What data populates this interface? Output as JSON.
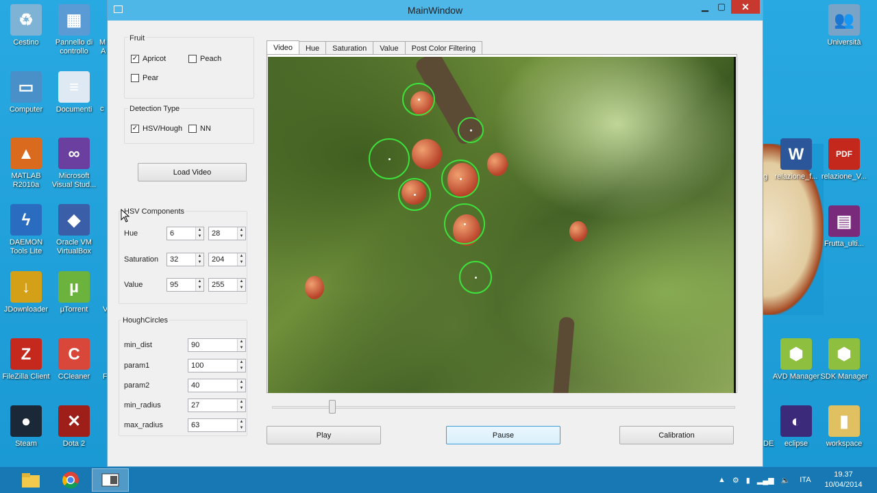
{
  "window": {
    "title": "MainWindow"
  },
  "fruit": {
    "title": "Fruit",
    "options": [
      {
        "label": "Apricot",
        "checked": true
      },
      {
        "label": "Peach",
        "checked": false
      },
      {
        "label": "Pear",
        "checked": false
      }
    ]
  },
  "detection": {
    "title": "Detection Type",
    "options": [
      {
        "label": "HSV/Hough",
        "checked": true
      },
      {
        "label": "NN",
        "checked": false
      }
    ]
  },
  "load_video_label": "Load Video",
  "hsv": {
    "title": "HSV Components",
    "rows": [
      {
        "label": "Hue",
        "min": "6",
        "max": "28"
      },
      {
        "label": "Saturation",
        "min": "32",
        "max": "204"
      },
      {
        "label": "Value",
        "min": "95",
        "max": "255"
      }
    ]
  },
  "hough": {
    "title": "HoughCircles",
    "rows": [
      {
        "label": "min_dist",
        "value": "90"
      },
      {
        "label": "param1",
        "value": "100"
      },
      {
        "label": "param2",
        "value": "40"
      },
      {
        "label": "min_radius",
        "value": "27"
      },
      {
        "label": "max_radius",
        "value": "63"
      }
    ]
  },
  "tabs": [
    "Video",
    "Hue",
    "Saturation",
    "Value",
    "Post Color Filtering"
  ],
  "active_tab": "Video",
  "playback": {
    "slider_position_fraction": 0.13
  },
  "controls": {
    "play": "Play",
    "pause": "Pause",
    "calibration": "Calibration"
  },
  "desktop_left": [
    {
      "label": "Cestino",
      "icon": "recycle-bin-icon",
      "color": "#7fb3d6",
      "glyph": "♻"
    },
    {
      "label": "Pannello di controllo",
      "icon": "control-panel-icon",
      "color": "#5b9bd5",
      "glyph": "▦"
    },
    {
      "label": "Computer",
      "icon": "computer-icon",
      "color": "#4a90c8",
      "glyph": "▭"
    },
    {
      "label": "Documenti",
      "icon": "documents-icon",
      "color": "#dfe9f3",
      "glyph": "≡"
    },
    {
      "label": "MATLAB R2010a",
      "icon": "matlab-icon",
      "color": "#d96a1e",
      "glyph": "▲"
    },
    {
      "label": "Microsoft Visual Stud...",
      "icon": "visual-studio-icon",
      "color": "#6a3fa0",
      "glyph": "∞"
    },
    {
      "label": "DAEMON Tools Lite",
      "icon": "daemon-tools-icon",
      "color": "#2a6cc0",
      "glyph": "ϟ"
    },
    {
      "label": "Oracle VM VirtualBox",
      "icon": "virtualbox-icon",
      "color": "#3a5ea8",
      "glyph": "◆"
    },
    {
      "label": "JDownloader",
      "icon": "jdownloader-icon",
      "color": "#d4a017",
      "glyph": "↓"
    },
    {
      "label": "µTorrent",
      "icon": "utorrent-icon",
      "color": "#6cb33e",
      "glyph": "µ"
    },
    {
      "label": "FileZilla Client",
      "icon": "filezilla-icon",
      "color": "#c5281c",
      "glyph": "Z"
    },
    {
      "label": "CCleaner",
      "icon": "ccleaner-icon",
      "color": "#d8473a",
      "glyph": "C"
    },
    {
      "label": "Steam",
      "icon": "steam-icon",
      "color": "#1b2838",
      "glyph": "●"
    },
    {
      "label": "Dota 2",
      "icon": "dota2-icon",
      "color": "#9e1f1a",
      "glyph": "✕"
    }
  ],
  "desktop_right": [
    {
      "label": "Università",
      "icon": "users-folder-icon",
      "color": "#7aa3c8",
      "glyph": "👥"
    },
    {
      "label": "relazione_f...",
      "icon": "word-doc-icon",
      "color": "#2b579a",
      "glyph": "W"
    },
    {
      "label": "relazione_V...",
      "icon": "pdf-icon",
      "color": "#c4281d",
      "glyph": "PDF"
    },
    {
      "label": "Frutta_ulti...",
      "icon": "rar-archive-icon",
      "color": "#7a2a7a",
      "glyph": "▤"
    },
    {
      "label": "AVD Manager",
      "icon": "android-icon",
      "color": "#8fbf3f",
      "glyph": "⬢"
    },
    {
      "label": "SDK Manager",
      "icon": "android-icon",
      "color": "#8fbf3f",
      "glyph": "⬢"
    },
    {
      "label": "eclipse",
      "icon": "eclipse-icon",
      "color": "#3b2a7a",
      "glyph": "◐"
    },
    {
      "label": "workspace",
      "icon": "folder-icon",
      "color": "#e0c060",
      "glyph": "▮"
    }
  ],
  "truncated_fragments": [
    "M",
    "A",
    "c",
    "V",
    "F",
    "DE",
    "g"
  ],
  "taskbar": {
    "tray_language": "ITA",
    "time": "19.37",
    "date": "10/04/2014"
  }
}
